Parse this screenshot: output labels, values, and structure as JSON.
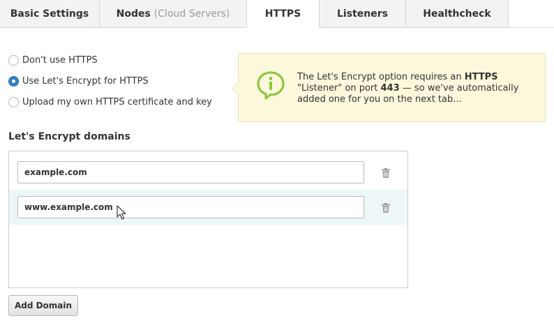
{
  "tabs": [
    {
      "label": "Basic Settings",
      "suffix": ""
    },
    {
      "label": "Nodes",
      "suffix": "(Cloud Servers)"
    },
    {
      "label": "HTTPS",
      "suffix": "",
      "active": true
    },
    {
      "label": "Listeners",
      "suffix": ""
    },
    {
      "label": "Healthcheck",
      "suffix": ""
    }
  ],
  "https_options": [
    {
      "label": "Don't use HTTPS",
      "checked": false
    },
    {
      "label": "Use Let's Encrypt for HTTPS",
      "checked": true
    },
    {
      "label": "Upload my own HTTPS certificate and key",
      "checked": false
    }
  ],
  "info": {
    "icon": "info-icon",
    "text_1": "The Let's Encrypt option requires an ",
    "strong_1": "HTTPS",
    "text_2": " \"Listener\" on port ",
    "strong_2": "443",
    "text_3": " — so we've automatically added one for you on the next tab...",
    "colors": {
      "background": "#fbf8dc",
      "icon": "#8dc63f"
    }
  },
  "domains": {
    "title": "Let's Encrypt domains",
    "items": [
      {
        "value": "example.com"
      },
      {
        "value": "www.example.com"
      }
    ],
    "add_label": "Add Domain"
  },
  "accent": "#2f7fc9"
}
